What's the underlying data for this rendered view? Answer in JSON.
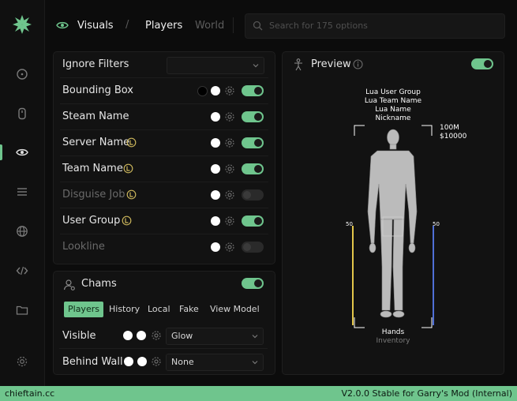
{
  "header": {
    "tabs": [
      {
        "label": "Visuals"
      },
      {
        "label": "Players"
      },
      {
        "label": "World"
      }
    ],
    "separator": "/",
    "search_placeholder": "Search for 175 options"
  },
  "filters": {
    "ignore_label": "Ignore Filters",
    "rows": [
      {
        "label": "Bounding Box"
      },
      {
        "label": "Steam Name"
      },
      {
        "label": "Server Name"
      },
      {
        "label": "Team Name"
      },
      {
        "label": "Disguise Job"
      },
      {
        "label": "User Group"
      },
      {
        "label": "Lookline"
      }
    ]
  },
  "chams": {
    "title": "Chams",
    "subtabs": [
      "Players",
      "History",
      "Local",
      "Fake",
      "View Model"
    ],
    "visible_label": "Visible",
    "visible_value": "Glow",
    "behind_label": "Behind Wall",
    "behind_value": "None"
  },
  "preview": {
    "title": "Preview",
    "lines": [
      "Lua User Group",
      "Lua Team Name",
      "Lua Name",
      "Nickname"
    ],
    "distance": "100M",
    "money": "$10000",
    "left_hp": "50",
    "right_hp": "50",
    "weapon": "Hands",
    "inventory": "Inventory"
  },
  "footer": {
    "brand": "chieftain.cc",
    "version": "V2.0.0 Stable for Garry's Mod (Internal)"
  },
  "colors": {
    "accent": "#6fc58d",
    "lua_badge": "#c8b35a"
  }
}
